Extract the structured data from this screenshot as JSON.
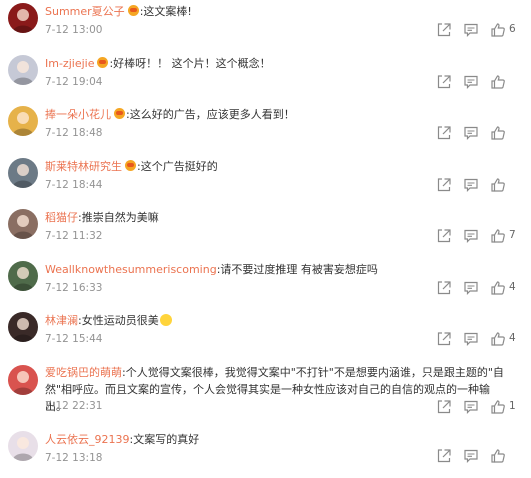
{
  "comments": [
    {
      "user": "Summer夏公子",
      "badge": true,
      "text": ":这文案棒!",
      "time": "7-12 13:00",
      "likes": "6",
      "avatar_color": "#8a1a1a"
    },
    {
      "user": "Im-zjiejie",
      "badge": true,
      "text": ":好棒呀！！ 这个片！这个概念！",
      "time": "7-12 19:04",
      "likes": "",
      "avatar_color": "#c6c9d6"
    },
    {
      "user": "捧一朵小花儿",
      "badge": true,
      "text": ":这么好的广告，应该更多人看到！",
      "time": "7-12 18:48",
      "likes": "",
      "avatar_color": "#e6b24a"
    },
    {
      "user": "斯莱特林研究生",
      "badge": true,
      "text": ":这个广告挺好的",
      "time": "7-12 18:44",
      "likes": "",
      "avatar_color": "#6c7a86"
    },
    {
      "user": "稻猫仔",
      "badge": false,
      "text": ":推崇自然为美嘛",
      "time": "7-12 11:32",
      "likes": "7",
      "avatar_color": "#8a6e62"
    },
    {
      "user": "Weallknowthesummeriscoming",
      "badge": false,
      "text": ":请不要过度推理 有被害妄想症吗",
      "time": "7-12 16:33",
      "likes": "4",
      "avatar_color": "#4f6b4a"
    },
    {
      "user": "林津澜",
      "badge": false,
      "text": ":女性运动员很美",
      "time": "7-12 15:44",
      "likes": "4",
      "avatar_color": "#3a2a28",
      "emoji": true
    },
    {
      "user": "爱吃锅巴的萌萌",
      "badge": false,
      "text": ":个人觉得文案很棒，我觉得文案中\"不打针\"不是想要内涵谁，只是跟主题的\"自然\"相呼应。而且文案的宣传，个人会觉得其实是一种女性应该对自己的自信的观点的一种输出。",
      "time": "7-12 22:31",
      "likes": "1",
      "avatar_color": "#d9534f",
      "multiline": true
    },
    {
      "user": "人云依云_92139",
      "badge": false,
      "text": ":文案写的真好",
      "time": "7-12 13:18",
      "likes": "",
      "avatar_color": "#e8dfe8"
    }
  ],
  "icons": {
    "share": "share-icon",
    "comment": "comment-icon",
    "like": "thumbs-up-icon"
  },
  "colors": {
    "username": "#eb7350",
    "time": "#939393",
    "icon": "#8a8a8a"
  }
}
